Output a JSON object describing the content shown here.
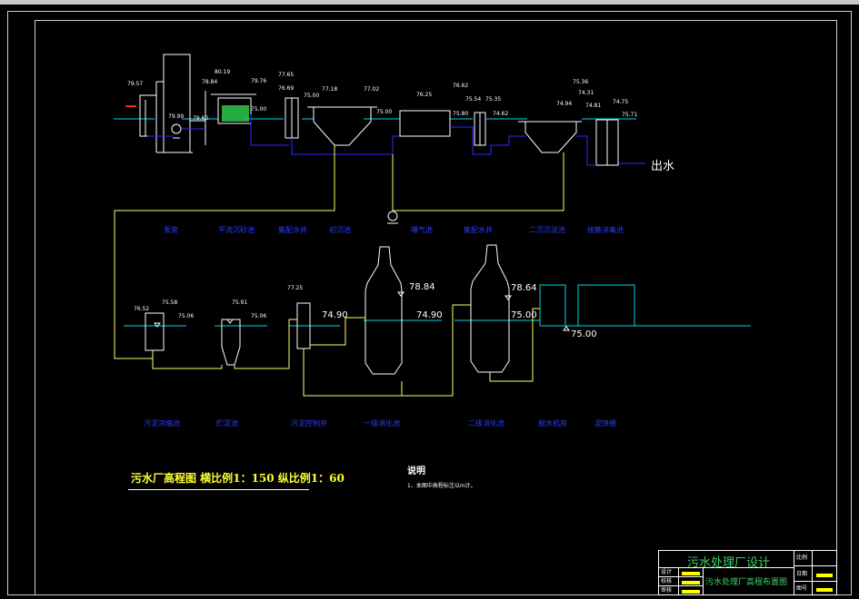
{
  "outlet_label": "出水",
  "title": "污水厂高程图  横比例1：150  纵比例1：60",
  "notes": {
    "heading": "说明",
    "text": "1、本图中高程标注以m计。"
  },
  "title_block": {
    "main": "污水处理厂设计",
    "sub": "污水处理厂高程布置图",
    "left_rows": [
      "设计",
      "校核",
      "审核"
    ],
    "right_rows": [
      "比例",
      "日期",
      "图号"
    ]
  },
  "top_labels": [
    "泵房",
    "平流沉砂池",
    "集配水井",
    "初沉池",
    "曝气池",
    "集配水井",
    "二沉沉淀池",
    "接触消毒池"
  ],
  "bottom_labels": [
    "污泥浓缩池",
    "贮泥池",
    "污泥控制井",
    "一级消化池",
    "二级消化池",
    "脱水机房",
    "泥饼棚"
  ],
  "top_elevations": [
    "79.57",
    "79.99",
    "79.60",
    "80.19",
    "78.84",
    "79.76",
    "79.04",
    "75.00",
    "77.65",
    "76.69",
    "75.00",
    "77.18",
    "77.02",
    "75.00",
    "76.25",
    "76.62",
    "75.80",
    "75.54",
    "75.35",
    "74.62",
    "75.36",
    "74.94",
    "74.31",
    "74.81",
    "74.75",
    "75.71"
  ],
  "bottom_elevations": [
    "76.52",
    "75.58",
    "75.06",
    "75.91",
    "75.06",
    "77.25"
  ],
  "bottom_big_elevations": [
    "74.90",
    "78.84",
    "74.90",
    "78.64",
    "75.00",
    "75.00"
  ],
  "colors": {
    "water": "#00d8e8",
    "pipe": "#2a2cff",
    "sludge": "#ffff66",
    "struct": "#ffffff",
    "grit": "#2ec84a",
    "red": "#ff2020",
    "green_text": "#41d06a"
  }
}
